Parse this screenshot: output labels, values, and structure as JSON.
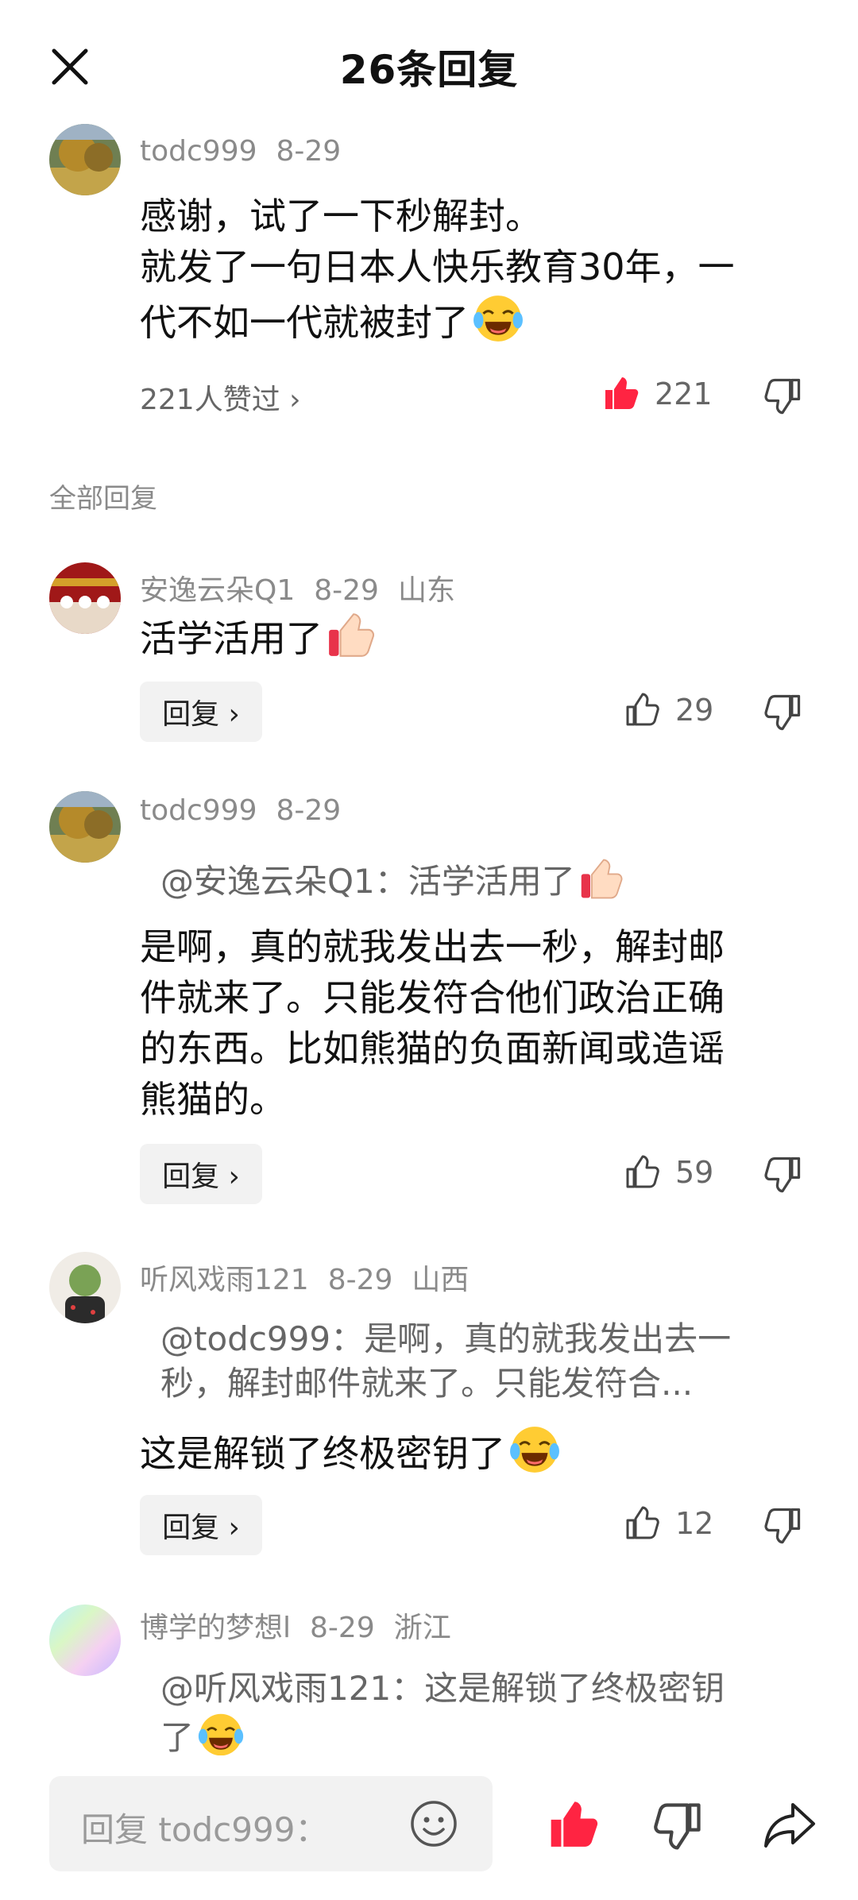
{
  "header": {
    "title": "26条回复"
  },
  "original": {
    "user": "todc999",
    "date": "8-29",
    "lines": [
      "感谢，试了一下秒解封。",
      "就发了一句日本人快乐教育30年，一",
      "代不如一代就被封了"
    ],
    "likers_text": "221人赞过 ›",
    "like_count": "221"
  },
  "section_label": "全部回复",
  "replies": [
    {
      "user": "安逸云朵Q1",
      "date": "8-29",
      "location": "山东",
      "text": "活学活用了",
      "reply_label": "回复 ›",
      "like_count": "29"
    },
    {
      "user": "todc999",
      "date": "8-29",
      "quote": "@安逸云朵Q1：活学活用了",
      "lines": [
        "是啊，真的就我发出去一秒，解封邮",
        "件就来了。只能发符合他们政治正确",
        "的东西。比如熊猫的负面新闻或造谣",
        "熊猫的。"
      ],
      "reply_label": "回复 ›",
      "like_count": "59"
    },
    {
      "user": "听风戏雨121",
      "date": "8-29",
      "location": "山西",
      "quote_lines": [
        "@todc999：是啊，真的就我发出去一",
        "秒，解封邮件就来了。只能发符合..."
      ],
      "text": "这是解锁了终极密钥了",
      "reply_label": "回复 ›",
      "like_count": "12"
    },
    {
      "user": "博学的梦想l",
      "date": "8-29",
      "location": "浙江",
      "quote_lines": [
        "@听风戏雨121：这是解锁了终极密钥",
        "了"
      ]
    }
  ],
  "bottom_bar": {
    "placeholder": "回复 todc999："
  },
  "colors": {
    "accent_red": "#ff2442",
    "muted": "#8a8a8a"
  },
  "icons": [
    "close-icon",
    "thumbs-up-icon",
    "thumbs-down-icon",
    "smile-icon",
    "share-icon",
    "laugh-cry-emoji",
    "thumbs-up-emoji"
  ]
}
